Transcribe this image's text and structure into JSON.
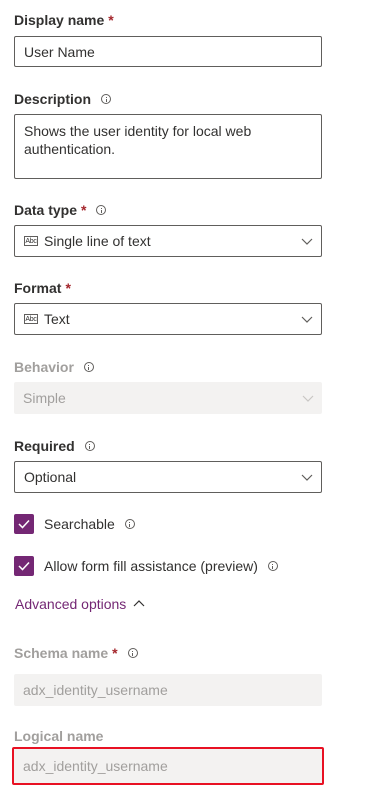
{
  "display_name": {
    "label": "Display name",
    "required_mark": "*",
    "value": "User Name"
  },
  "description": {
    "label": "Description",
    "info_icon": "info-icon",
    "value": "Shows the user identity for local web authentication."
  },
  "data_type": {
    "label": "Data type",
    "required_mark": "*",
    "info_icon": "info-icon",
    "type_icon": "Abc",
    "value": "Single line of text"
  },
  "format": {
    "label": "Format",
    "required_mark": "*",
    "type_icon": "Abc",
    "value": "Text"
  },
  "behavior": {
    "label": "Behavior",
    "info_icon": "info-icon",
    "value": "Simple"
  },
  "required": {
    "label": "Required",
    "info_icon": "info-icon",
    "value": "Optional"
  },
  "searchable": {
    "label": "Searchable",
    "checked": true
  },
  "form_fill": {
    "label": "Allow form fill assistance (preview)",
    "checked": true
  },
  "advanced_options": {
    "label": "Advanced options",
    "expanded": true
  },
  "schema_name": {
    "label": "Schema name",
    "required_mark": "*",
    "info_icon": "info-icon",
    "value": "adx_identity_username"
  },
  "logical_name": {
    "label": "Logical name",
    "value": "adx_identity_username"
  },
  "colors": {
    "accent": "#742774",
    "required": "#a4262c",
    "highlight": "#e81123",
    "disabled_bg": "#f3f2f1",
    "disabled_text": "#a19f9d"
  }
}
